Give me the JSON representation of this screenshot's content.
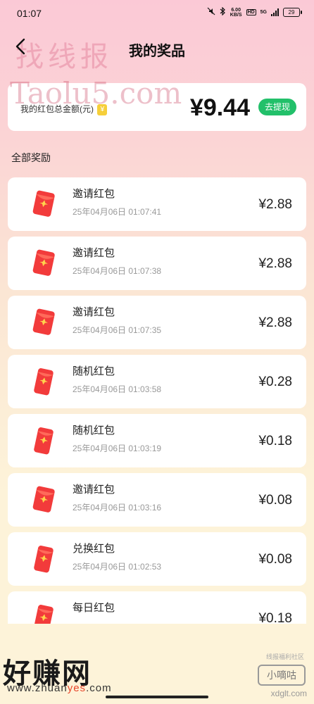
{
  "status_bar": {
    "time": "01:07",
    "speed_value": "6.00",
    "speed_unit": "KB/S",
    "hd": "HD",
    "network": "5G",
    "battery": "29"
  },
  "nav": {
    "title": "我的奖品",
    "back_icon": "chevron-left-icon"
  },
  "summary": {
    "label": "我的红包总金额(元)",
    "coin_symbol": "¥",
    "amount": "¥9.44",
    "withdraw_label": "去提现"
  },
  "section_title": "全部奖励",
  "rewards": [
    {
      "title": "邀请红包",
      "time": "25年04月06日 01:07:41",
      "amount": "¥2.88"
    },
    {
      "title": "邀请红包",
      "time": "25年04月06日 01:07:38",
      "amount": "¥2.88"
    },
    {
      "title": "邀请红包",
      "time": "25年04月06日 01:07:35",
      "amount": "¥2.88"
    },
    {
      "title": "随机红包",
      "time": "25年04月06日 01:03:58",
      "amount": "¥0.28"
    },
    {
      "title": "随机红包",
      "time": "25年04月06日 01:03:19",
      "amount": "¥0.18"
    },
    {
      "title": "邀请红包",
      "time": "25年04月06日 01:03:16",
      "amount": "¥0.08"
    },
    {
      "title": "兑换红包",
      "time": "25年04月06日 01:02:53",
      "amount": "¥0.08"
    },
    {
      "title": "每日红包",
      "time": "",
      "amount": "¥0.18"
    }
  ],
  "watermarks": {
    "top": "找线报",
    "taolu": "Taolu5.com",
    "haozhuan": "好赚网",
    "url_prefix": "www.zhuan",
    "url_accent": "yes",
    "url_suffix": ".com",
    "xiaodigu_sub": "线报福利社区",
    "xiaodigu": "小嘀咕",
    "xdglt": "xdglt.com"
  },
  "colors": {
    "accent_green": "#22c06a",
    "envelope_red": "#f23b3b"
  }
}
